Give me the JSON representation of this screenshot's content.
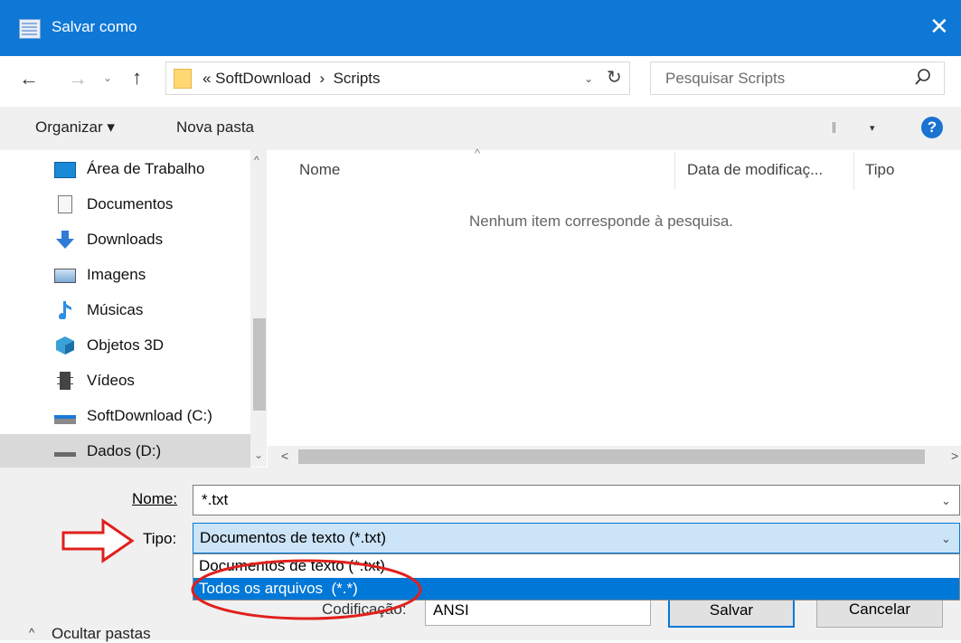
{
  "window": {
    "title": "Salvar como",
    "close_glyph": "✕"
  },
  "nav_buttons": {
    "back": "←",
    "forward": "→",
    "recent": "⌄",
    "up": "↑"
  },
  "address": {
    "breadcrumb": "« SoftDownload  ›  Scripts",
    "dropdown_glyph": "⌄",
    "refresh_glyph": "↻"
  },
  "search": {
    "placeholder": "Pesquisar Scripts",
    "icon": "search-icon"
  },
  "toolbar": {
    "organize": "Organizar ▾",
    "new_folder": "Nova pasta",
    "view_arrow": "▾",
    "help": "?"
  },
  "sidebar": {
    "items": [
      {
        "label": "Área de Trabalho",
        "icon": "desktop-icon"
      },
      {
        "label": "Documentos",
        "icon": "documents-icon"
      },
      {
        "label": "Downloads",
        "icon": "downloads-icon"
      },
      {
        "label": "Imagens",
        "icon": "pictures-icon"
      },
      {
        "label": "Músicas",
        "icon": "music-icon"
      },
      {
        "label": "Objetos 3D",
        "icon": "objects-3d-icon"
      },
      {
        "label": "Vídeos",
        "icon": "videos-icon"
      },
      {
        "label": "SoftDownload (C:)",
        "icon": "drive-c-icon"
      },
      {
        "label": "Dados (D:)",
        "icon": "drive-d-icon",
        "selected": true
      }
    ]
  },
  "file_list": {
    "columns": [
      "Nome",
      "Data de modificaç...",
      "Tipo"
    ],
    "sort_glyph": "^",
    "empty_message": "Nenhum item corresponde à pesquisa."
  },
  "form": {
    "name_label": "Nome:",
    "name_value": "*.txt",
    "type_label": "Tipo:",
    "type_value": "Documentos de texto (*.txt)",
    "type_options": [
      "Documentos de texto (*.txt)",
      "Todos os arquivos  (*.*)"
    ],
    "highlighted_option": 1,
    "encoding_label": "Codificação:",
    "encoding_value": "ANSI",
    "save_label": "Salvar",
    "cancel_label": "Cancelar",
    "hide_folders_label": "Ocultar pastas",
    "chevron": "⌄"
  },
  "colors": {
    "accent": "#0078d7",
    "titlebar": "#0f78d7",
    "annotation": "#e0201c"
  }
}
